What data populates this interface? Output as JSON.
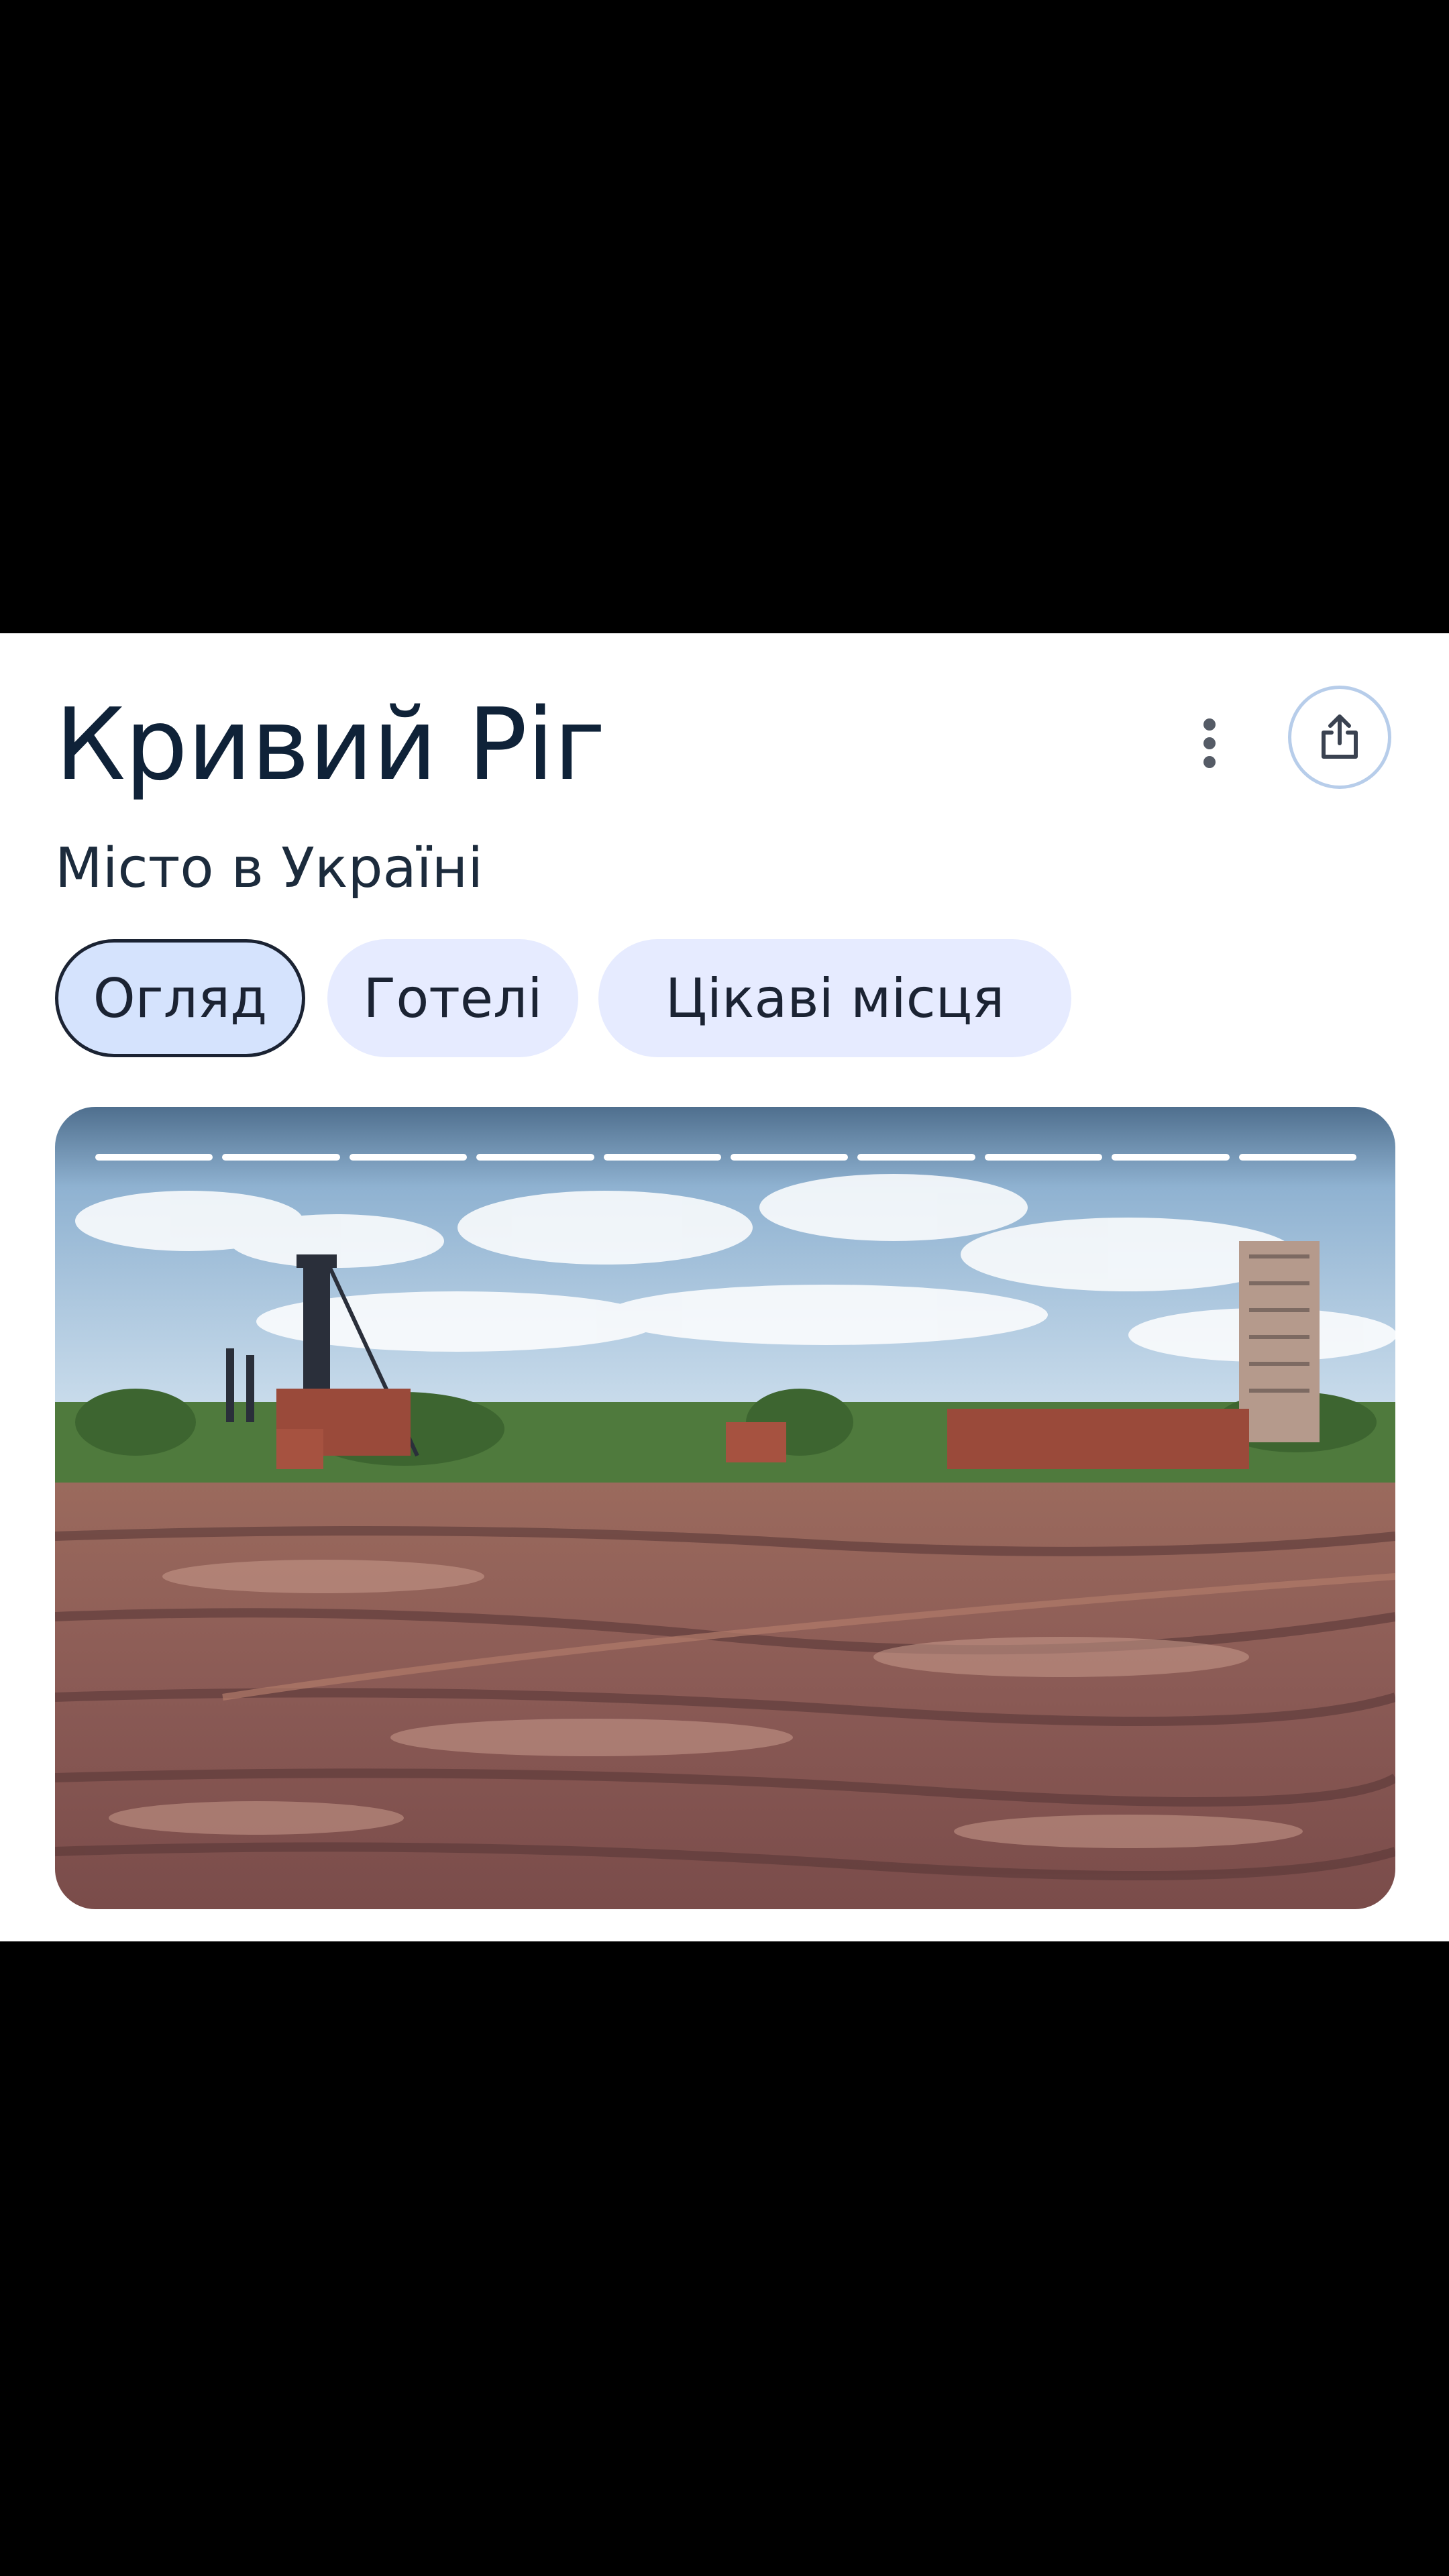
{
  "header": {
    "title": "Кривий Ріг",
    "subtitle": "Місто в Україні"
  },
  "actions": {
    "more_icon": "more-vert-icon",
    "share_icon": "share-icon"
  },
  "tabs": [
    {
      "label": "Огляд",
      "active": true
    },
    {
      "label": "Готелі",
      "active": false
    },
    {
      "label": "Цікаві місця",
      "active": false
    }
  ],
  "media": {
    "description_icon": "city-photo",
    "slide_count": 10
  },
  "colors": {
    "title": "#0f2238",
    "chip_bg": "#e6ebff",
    "chip_active_bg": "#d5e3fd",
    "share_border": "#b7cdea"
  }
}
